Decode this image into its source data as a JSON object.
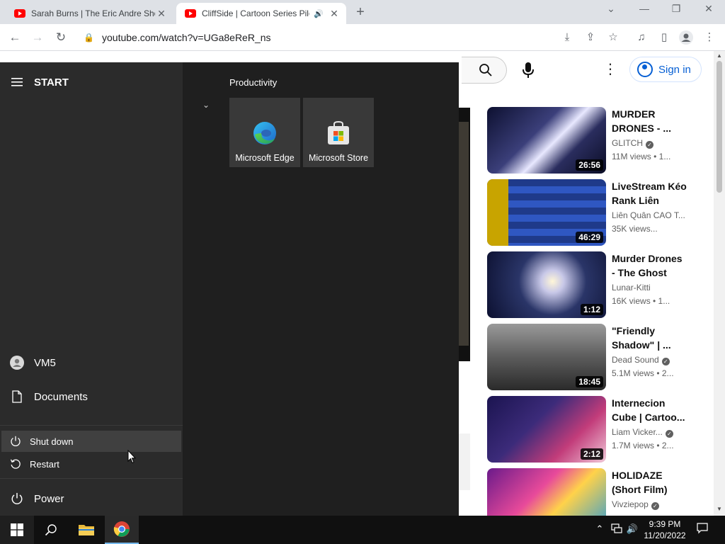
{
  "browser": {
    "tabs": [
      {
        "title": "Sarah Burns | The Eric Andre Sho",
        "active": false,
        "close": "✕"
      },
      {
        "title": "CliffSide | Cartoon Series Pilo",
        "active": true,
        "close": "✕",
        "audio": "🔊"
      }
    ],
    "new_tab": "+",
    "window_controls": {
      "dropdown": "⌄",
      "minimize": "—",
      "restore": "❐",
      "close": "✕"
    },
    "address": "youtube.com/watch?v=UGa8eReR_ns"
  },
  "youtube": {
    "signin": "Sign in",
    "recommendations": [
      {
        "title": "MURDER DRONES - ...",
        "channel": "GLITCH",
        "verified": true,
        "meta": "11M views  •  1...",
        "duration": "26:56"
      },
      {
        "title": "LiveStream Kéo Rank Liên Quâ...",
        "channel": "Liên Quân CAO T...",
        "verified": false,
        "meta": "35K views...",
        "duration": "46:29"
      },
      {
        "title": "Murder Drones - The Ghost",
        "channel": "Lunar-Kitti",
        "verified": false,
        "meta": "16K views  •  1...",
        "duration": "1:12"
      },
      {
        "title": "\"Friendly Shadow\" | ...",
        "channel": "Dead Sound",
        "verified": true,
        "meta": "5.1M views  •  2...",
        "duration": "18:45"
      },
      {
        "title": "Internecion Cube | Cartoo...",
        "channel": "Liam Vicker...",
        "verified": true,
        "meta": "1.7M views  •  2...",
        "duration": "2:12"
      },
      {
        "title": "HOLIDAZE (Short Film)",
        "channel": "Vivziepop",
        "verified": true,
        "meta": "",
        "duration": ""
      }
    ]
  },
  "start_menu": {
    "header": "START",
    "user": "VM5",
    "documents": "Documents",
    "power": "Power",
    "power_menu": [
      "Shut down",
      "Restart"
    ],
    "group_label": "Productivity",
    "tiles": [
      "Microsoft Edge",
      "Microsoft Store"
    ]
  },
  "taskbar": {
    "time": "9:39 PM",
    "date": "11/20/2022"
  },
  "colors": {
    "youtube_red": "#ff0000",
    "link_blue": "#065fd4",
    "start_bg": "#1f1f1f",
    "taskbar_bg": "#101010"
  }
}
